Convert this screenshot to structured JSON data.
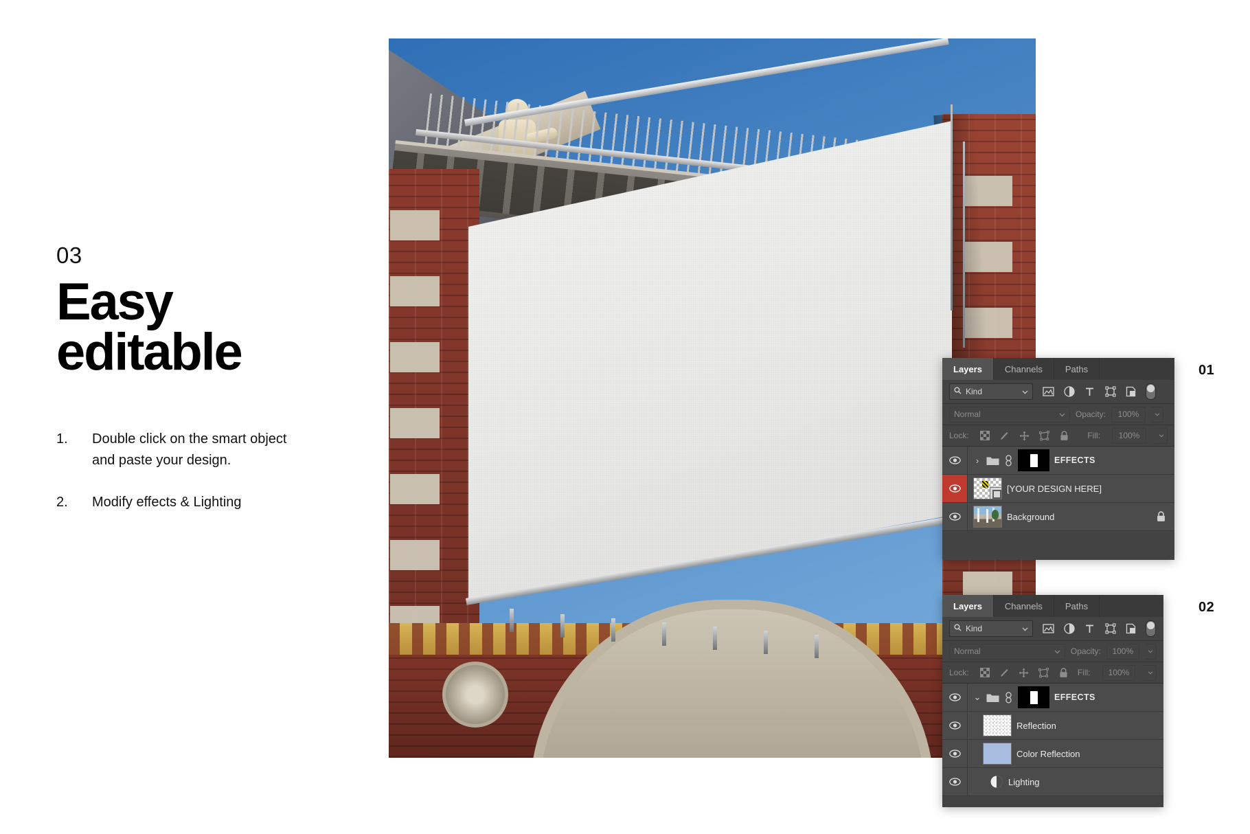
{
  "left": {
    "step_number": "03",
    "headline_line1": "Easy",
    "headline_line2": "editable",
    "instructions": [
      {
        "num": "1.",
        "text": "Double click on the smart object and paste your design."
      },
      {
        "num": "2.",
        "text": "Modify effects & Lighting"
      }
    ]
  },
  "photo": {
    "alt_name": "billboard-banner-on-brick-building",
    "banner_label": ""
  },
  "panels": [
    {
      "tag": "01",
      "tabs": [
        {
          "label": "Layers",
          "active": true
        },
        {
          "label": "Channels",
          "active": false
        },
        {
          "label": "Paths",
          "active": false
        }
      ],
      "filter": {
        "kind_label": "Kind",
        "search_icon": "search-icon",
        "chevron": "⌄",
        "icons": [
          "pixel-layer-filter-icon",
          "adjustment-layer-filter-icon",
          "type-layer-filter-icon",
          "shape-layer-filter-icon",
          "smart-object-filter-icon",
          "filter-toggle-switch"
        ]
      },
      "blend": {
        "mode": "Normal",
        "opacity_label": "Opacity:",
        "opacity_value": "100%"
      },
      "lock": {
        "label": "Lock:",
        "fill_label": "Fill:",
        "fill_value": "100%",
        "icons": [
          "lock-transparent-pixels-icon",
          "lock-image-pixels-icon",
          "lock-position-icon",
          "lock-artboard-nesting-icon",
          "lock-all-icon"
        ]
      },
      "layers": [
        {
          "name": "EFFECTS",
          "type": "group",
          "caps": true,
          "expanded": false,
          "disclosure": "›",
          "visible": true,
          "eye_highlighted": false,
          "has_mask": true,
          "has_link": true,
          "locked": false
        },
        {
          "name": "[YOUR DESIGN HERE]",
          "type": "smart-object",
          "caps": false,
          "visible": true,
          "eye_highlighted": true,
          "has_mask": false,
          "has_link": false,
          "locked": false
        },
        {
          "name": "Background",
          "type": "image",
          "caps": false,
          "visible": true,
          "eye_highlighted": false,
          "has_mask": false,
          "has_link": false,
          "locked": true
        }
      ]
    },
    {
      "tag": "02",
      "tabs": [
        {
          "label": "Layers",
          "active": true
        },
        {
          "label": "Channels",
          "active": false
        },
        {
          "label": "Paths",
          "active": false
        }
      ],
      "filter": {
        "kind_label": "Kind",
        "search_icon": "search-icon",
        "chevron": "⌄",
        "icons": [
          "pixel-layer-filter-icon",
          "adjustment-layer-filter-icon",
          "type-layer-filter-icon",
          "shape-layer-filter-icon",
          "smart-object-filter-icon",
          "filter-toggle-switch"
        ]
      },
      "blend": {
        "mode": "Normal",
        "opacity_label": "Opacity:",
        "opacity_value": "100%"
      },
      "lock": {
        "label": "Lock:",
        "fill_label": "Fill:",
        "fill_value": "100%",
        "icons": [
          "lock-transparent-pixels-icon",
          "lock-image-pixels-icon",
          "lock-position-icon",
          "lock-artboard-nesting-icon",
          "lock-all-icon"
        ]
      },
      "layers": [
        {
          "name": "EFFECTS",
          "type": "group",
          "caps": true,
          "expanded": true,
          "disclosure": "⌄",
          "visible": true,
          "eye_highlighted": false,
          "has_mask": true,
          "has_link": true,
          "locked": false
        },
        {
          "name": "Reflection",
          "type": "transparent",
          "caps": false,
          "visible": true,
          "eye_highlighted": false,
          "indented": true,
          "locked": false
        },
        {
          "name": "Color Reflection",
          "type": "swatch",
          "swatch_color": "#a8bde0",
          "caps": false,
          "visible": true,
          "eye_highlighted": false,
          "indented": true,
          "locked": false
        },
        {
          "name": "Lighting",
          "type": "adjustment",
          "caps": false,
          "visible": true,
          "eye_highlighted": false,
          "indented": true,
          "locked": false
        }
      ]
    }
  ],
  "colors": {
    "panel_bg": "#434343",
    "panel_row": "#4b4b4b",
    "tab_active": "#535353",
    "highlight_red": "#c0392f",
    "swatch_blue": "#a8bde0",
    "page_bg": "#ffffff",
    "text_dark": "#111111"
  }
}
